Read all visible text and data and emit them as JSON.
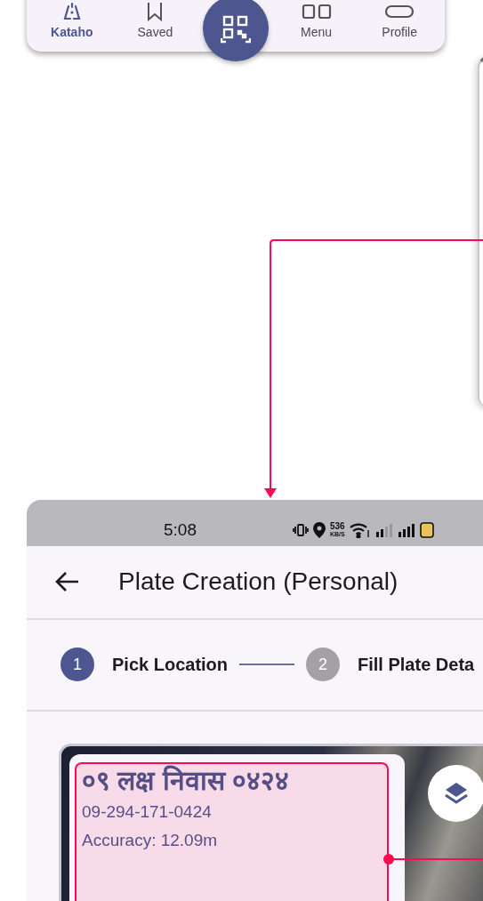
{
  "bottom_nav": {
    "items": [
      {
        "label": "Kataho",
        "selected": true
      },
      {
        "label": "Saved",
        "selected": false
      },
      {
        "label": "Menu",
        "selected": false
      },
      {
        "label": "Profile",
        "selected": false
      }
    ]
  },
  "phone": {
    "status_bar": {
      "time": "5:08",
      "speed": "536",
      "speed_unit": "KB/S"
    },
    "app_bar": {
      "title": "Plate Creation (Personal)"
    },
    "stepper": {
      "steps": [
        {
          "number": "1",
          "label": "Pick Location",
          "selected": true
        },
        {
          "number": "2",
          "label": "Fill Plate Deta",
          "selected": false
        }
      ]
    },
    "map_card": {
      "plate_name": "०९ लक्ष निवास ०४२४",
      "plate_code": "09-294-171-0424",
      "accuracy": "Accuracy: 12.09m"
    }
  }
}
